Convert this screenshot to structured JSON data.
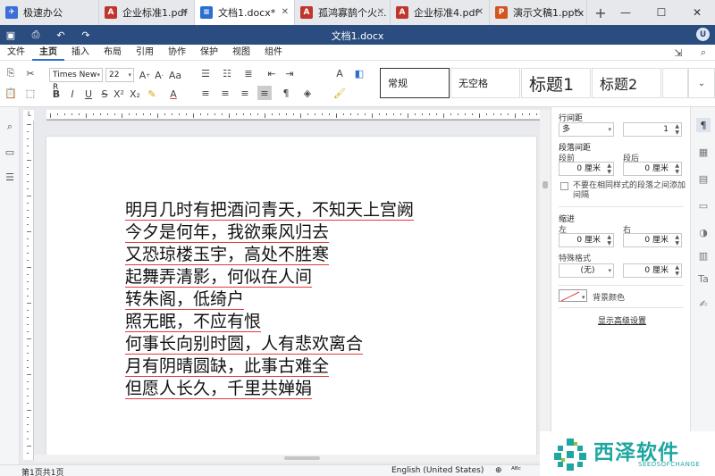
{
  "tabs": [
    {
      "label": "极速办公",
      "icon": "rocket-icon",
      "color": "#3b6fd6",
      "active": false
    },
    {
      "label": "企业标准1.pdf",
      "icon": "pdf-icon",
      "color": "#c0362c",
      "active": false
    },
    {
      "label": "文档1.docx*",
      "icon": "doc-icon",
      "color": "#2b6fd1",
      "active": true
    },
    {
      "label": "孤鸿寡鹄个火...",
      "icon": "pdf-icon",
      "color": "#c0362c",
      "active": false
    },
    {
      "label": "企业标准4.pdf",
      "icon": "pdf-icon",
      "color": "#c0362c",
      "active": false
    },
    {
      "label": "演示文稿1.pptx",
      "icon": "ppt-icon",
      "color": "#d3541c",
      "active": false
    }
  ],
  "titlebar": {
    "doc_title": "文档1.docx",
    "user_initial": "U",
    "accent": "#2b4c7e"
  },
  "menus": [
    "文件",
    "主页",
    "插入",
    "布局",
    "引用",
    "协作",
    "保护",
    "视图",
    "组件"
  ],
  "active_menu": "主页",
  "ribbon": {
    "font_name": "Times New R",
    "font_size": "22",
    "styles": [
      "常规",
      "无空格",
      "标题1",
      "标题2"
    ]
  },
  "document": {
    "lines": [
      "明月几时有把酒问青天，不知天上宫阙",
      "今夕是何年，我欲乘风归去",
      "又恐琼楼玉宇，高处不胜寒",
      "起舞弄清影，何似在人间",
      "转朱阁，低绮户",
      "照无眠，不应有恨",
      "何事长向别时圆，人有悲欢离合",
      "月有阴晴圆缺，此事古难全",
      "但愿人长久，千里共婵娟"
    ],
    "underline_color": "#e23b3b"
  },
  "panel": {
    "line_spacing_title": "行间距",
    "line_spacing_mode": "多",
    "line_spacing_value": "1",
    "para_spacing_title": "段落间距",
    "before_label": "段前",
    "after_label": "段后",
    "before_value": "0 厘米",
    "after_value": "0 厘米",
    "no_space_checkbox": "不要在相同样式的段落之间添加间隔",
    "indent_title": "缩进",
    "left_label": "左",
    "right_label": "右",
    "left_value": "0 厘米",
    "right_value": "0 厘米",
    "special_title": "特殊格式",
    "special_value": "(无)",
    "special_amount": "0 厘米",
    "bg_color_label": "背景颜色",
    "advanced_link": "显示高级设置"
  },
  "status": {
    "page_info": "第1页共1页",
    "language": "English (United States)"
  },
  "watermark": {
    "title": "西泽软件",
    "subtitle": "SEEDSOFCHANGE",
    "color": "#1fa6a0"
  }
}
